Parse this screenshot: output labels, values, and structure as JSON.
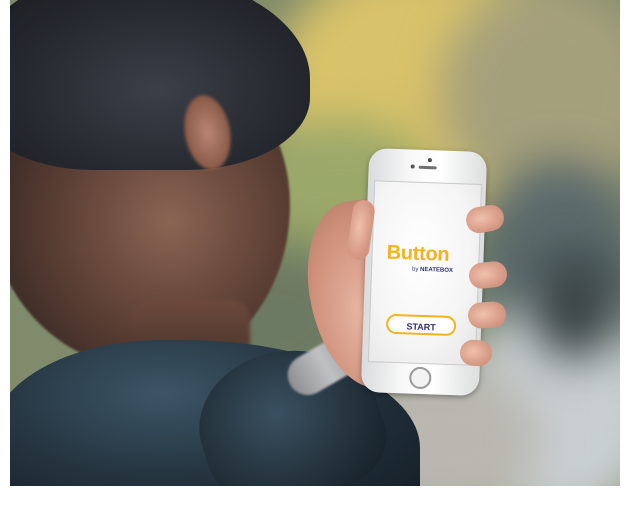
{
  "scene": {
    "description_free": true
  },
  "phone_screen": {
    "app_name": "Button",
    "byline_prefix": "by",
    "byline_brand": "NEATEBOX",
    "start_label": "START",
    "accent_color": "#f2b31e",
    "text_color": "#2b2f70"
  },
  "icons": {
    "home": "home-button-icon"
  }
}
